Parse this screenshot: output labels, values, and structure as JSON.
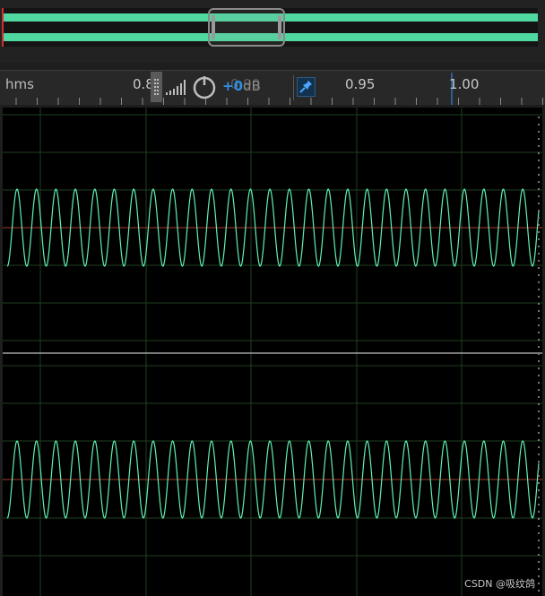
{
  "ruler": {
    "time_format": "hms",
    "ticks": [
      "0.85",
      "0.90",
      "0.95",
      "1.00"
    ]
  },
  "hud": {
    "gain_value": "+0",
    "gain_unit": "dB"
  },
  "icons": {
    "level_meter": "level-meter-icon",
    "gain_knob": "volume-knob-icon",
    "pin": "pin-icon"
  },
  "colors": {
    "waveform": "#5ff2b2",
    "centerline": "#c0392b",
    "grid": "#1c3a1c",
    "accent": "#2f8ee6",
    "playhead": "#d32d2d"
  },
  "watermark": "CSDN @吸纹鸽"
}
